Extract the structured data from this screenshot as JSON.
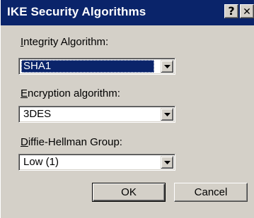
{
  "window": {
    "title": "IKE Security Algorithms",
    "help_glyph": "?",
    "close_glyph": "✕"
  },
  "integrity": {
    "label_first": "I",
    "label_rest": "ntegrity Algorithm:",
    "value": "SHA1"
  },
  "encryption": {
    "label_first": "E",
    "label_rest": "ncryption algorithm:",
    "value": "3DES"
  },
  "dh_group": {
    "label_first": "D",
    "label_rest": "iffie-Hellman Group:",
    "value": "Low (1)"
  },
  "buttons": {
    "ok": "OK",
    "cancel": "Cancel"
  },
  "icons": {
    "help": "help-icon",
    "close": "close-icon",
    "dropdown": "dropdown-arrow-icon"
  },
  "colors": {
    "titlebar": "#0a246a",
    "face": "#d4d0c8",
    "selection": "#0a246a"
  }
}
